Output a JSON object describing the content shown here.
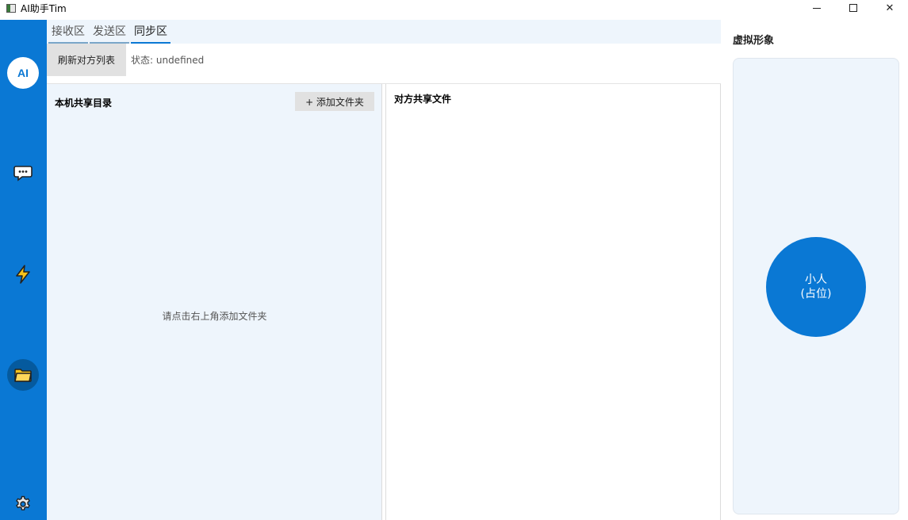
{
  "window": {
    "title": "AI助手Tim",
    "minimize_icon": "minimize-icon",
    "maximize_icon": "maximize-icon",
    "close_label": "✕"
  },
  "rail": {
    "logo": "AI",
    "items": [
      {
        "name": "chat",
        "icon": "chat-icon"
      },
      {
        "name": "quick",
        "icon": "lightning-icon"
      },
      {
        "name": "files",
        "icon": "folder-icon",
        "active": true
      },
      {
        "name": "settings",
        "icon": "gear-icon"
      }
    ]
  },
  "tabs": [
    {
      "label": "接收区"
    },
    {
      "label": "发送区"
    },
    {
      "label": "同步区",
      "active": true
    }
  ],
  "toolbar": {
    "refresh_label": "刷新对方列表",
    "status_text": "状态: undefined"
  },
  "local_panel": {
    "title": "本机共享目录",
    "add_folder_label": "+ 添加文件夹",
    "empty_hint": "请点击右上角添加文件夹"
  },
  "remote_panel": {
    "title": "对方共享文件"
  },
  "avatar": {
    "title": "虚拟形象",
    "line1": "小人",
    "line2": "(占位)"
  },
  "colors": {
    "accent": "#0a78d4",
    "panel_bg": "#eef5fc"
  }
}
